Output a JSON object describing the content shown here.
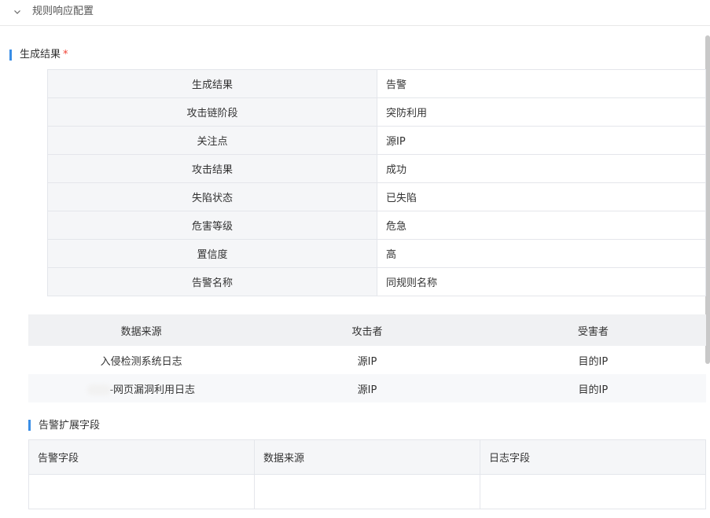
{
  "section": {
    "title": "规则响应配置"
  },
  "result": {
    "title": "生成结果",
    "required_mark": "*",
    "rows": [
      {
        "key": "生成结果",
        "value": "告警"
      },
      {
        "key": "攻击链阶段",
        "value": "突防利用"
      },
      {
        "key": "关注点",
        "value": "源IP"
      },
      {
        "key": "攻击结果",
        "value": "成功"
      },
      {
        "key": "失陷状态",
        "value": "已失陷"
      },
      {
        "key": "危害等级",
        "value": "危急"
      },
      {
        "key": "置信度",
        "value": "高"
      },
      {
        "key": "告警名称",
        "value": "同规则名称"
      }
    ]
  },
  "sources": {
    "headers": [
      "数据来源",
      "攻击者",
      "受害者"
    ],
    "rows": [
      {
        "source": "入侵检测系统日志",
        "attacker": "源IP",
        "victim": "目的IP"
      },
      {
        "source": "-网页漏洞利用日志",
        "attacker": "源IP",
        "victim": "目的IP"
      }
    ]
  },
  "extension": {
    "title": "告警扩展字段",
    "headers": [
      "告警字段",
      "数据来源",
      "日志字段"
    ]
  }
}
